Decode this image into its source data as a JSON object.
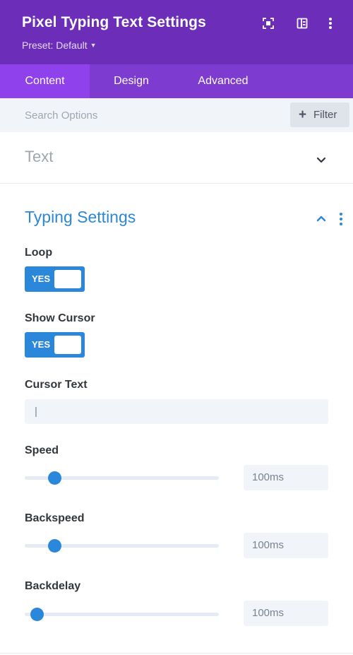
{
  "header": {
    "title": "Pixel Typing Text Settings",
    "preset": "Preset: Default",
    "icons": [
      "expand-icon",
      "split-layout-icon",
      "more-vertical-icon"
    ]
  },
  "tabs": [
    {
      "label": "Content",
      "active": true
    },
    {
      "label": "Design",
      "active": false
    },
    {
      "label": "Advanced",
      "active": false
    }
  ],
  "search": {
    "placeholder": "Search Options",
    "filter_label": "Filter"
  },
  "sections": {
    "text": {
      "title": "Text"
    },
    "typing": {
      "title": "Typing Settings",
      "loop": {
        "label": "Loop",
        "toggle": "YES"
      },
      "show_cursor": {
        "label": "Show Cursor",
        "toggle": "YES"
      },
      "cursor_text": {
        "label": "Cursor Text",
        "value": "|"
      },
      "speed": {
        "label": "Speed",
        "value": "100ms",
        "slider_fraction": 0.155
      },
      "backspeed": {
        "label": "Backspeed",
        "value": "100ms",
        "slider_fraction": 0.155
      },
      "backdelay": {
        "label": "Backdelay",
        "value": "100ms",
        "slider_fraction": 0.065
      }
    }
  },
  "colors": {
    "header_bg": "#6c2eb9",
    "tabs_bg": "#7e3bd0",
    "active_tab": "#8f42ec",
    "accent_blue": "#2b87da"
  }
}
